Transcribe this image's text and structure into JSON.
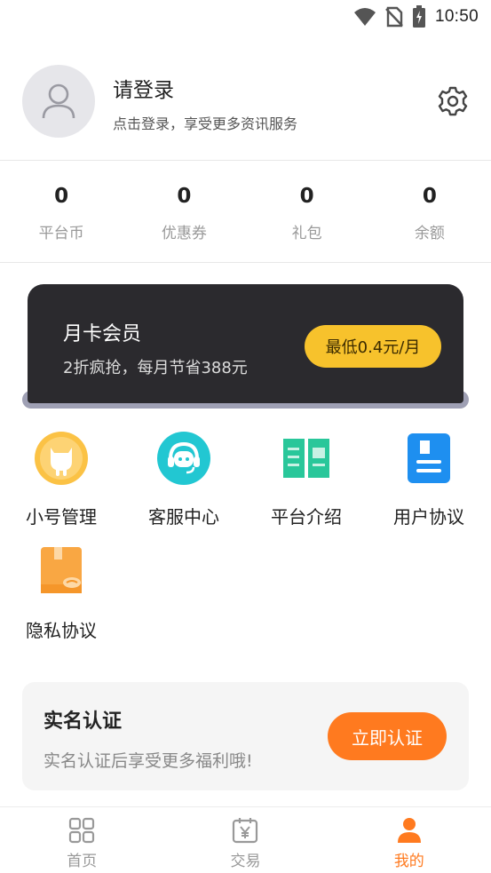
{
  "status_bar": {
    "time": "10:50"
  },
  "profile": {
    "title": "请登录",
    "subtitle": "点击登录，享受更多资讯服务"
  },
  "stats": [
    {
      "value": "0",
      "label": "平台币"
    },
    {
      "value": "0",
      "label": "优惠券"
    },
    {
      "value": "0",
      "label": "礼包"
    },
    {
      "value": "0",
      "label": "余额"
    }
  ],
  "vip": {
    "title": "月卡会员",
    "subtitle": "2折疯抢，每月节省388元",
    "button": "最低0.4元/月"
  },
  "menu": [
    {
      "label": "小号管理",
      "icon": "cat-icon"
    },
    {
      "label": "客服中心",
      "icon": "headset-icon"
    },
    {
      "label": "平台介绍",
      "icon": "book-icon"
    },
    {
      "label": "用户协议",
      "icon": "document-icon"
    },
    {
      "label": "隐私协议",
      "icon": "privacy-doc-icon"
    }
  ],
  "verify": {
    "title": "实名认证",
    "subtitle": "实名认证后享受更多福利哦!",
    "button": "立即认证"
  },
  "tabbar": [
    {
      "label": "首页",
      "icon": "grid-icon",
      "active": false
    },
    {
      "label": "交易",
      "icon": "calendar-yen-icon",
      "active": false
    },
    {
      "label": "我的",
      "icon": "user-icon",
      "active": true
    }
  ],
  "colors": {
    "accent": "#ff7a1f",
    "vip_button": "#f7c22c",
    "vip_card": "#2b2a2e"
  }
}
